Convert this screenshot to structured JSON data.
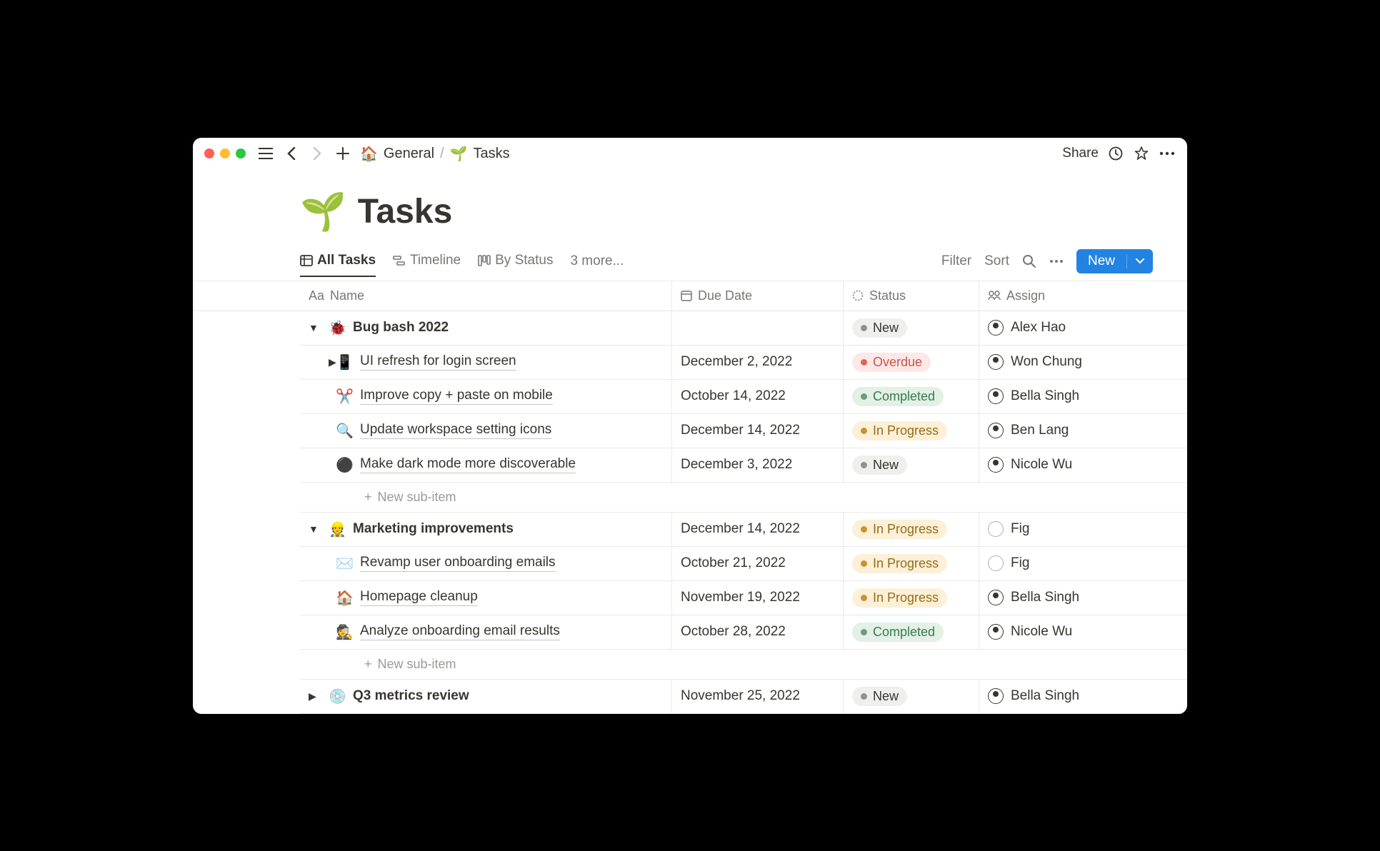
{
  "titlebar": {
    "share": "Share",
    "breadcrumb": {
      "parent_icon": "🏠",
      "parent": "General",
      "current_icon": "🌱",
      "current": "Tasks"
    }
  },
  "page": {
    "emoji": "🌱",
    "title": "Tasks"
  },
  "views": {
    "tabs": [
      {
        "icon": "table",
        "label": "All Tasks",
        "active": true
      },
      {
        "icon": "timeline",
        "label": "Timeline",
        "active": false
      },
      {
        "icon": "board",
        "label": "By Status",
        "active": false
      }
    ],
    "more": "3 more...",
    "actions": {
      "filter": "Filter",
      "sort": "Sort",
      "new": "New"
    }
  },
  "columns": {
    "name": "Name",
    "due": "Due Date",
    "status": "Status",
    "assign": "Assign"
  },
  "newSubItem": "New sub-item",
  "rows": [
    {
      "type": "group",
      "expanded": true,
      "emoji": "🐞",
      "title": "Bug bash 2022",
      "due": "",
      "status": "New",
      "assignee": "Alex Hao"
    },
    {
      "type": "child",
      "toggle": true,
      "emoji": "📱",
      "title": "UI refresh for login screen",
      "due": "December 2, 2022",
      "status": "Overdue",
      "assignee": "Won Chung"
    },
    {
      "type": "child",
      "emoji": "✂️",
      "title": "Improve copy + paste on mobile",
      "due": "October 14, 2022",
      "status": "Completed",
      "assignee": "Bella Singh"
    },
    {
      "type": "child",
      "emoji": "🔍",
      "title": "Update workspace setting icons",
      "due": "December 14, 2022",
      "status": "In Progress",
      "assignee": "Ben Lang"
    },
    {
      "type": "child",
      "emoji": "⚫",
      "title": "Make dark mode more discoverable",
      "due": "December 3, 2022",
      "status": "New",
      "assignee": "Nicole Wu"
    },
    {
      "type": "subnew"
    },
    {
      "type": "group",
      "expanded": true,
      "emoji": "👷",
      "title": "Marketing improvements",
      "due": "December 14, 2022",
      "status": "In Progress",
      "assignee": "Fig",
      "avatar": "cat"
    },
    {
      "type": "child",
      "emoji": "✉️",
      "title": "Revamp user onboarding emails",
      "due": "October 21, 2022",
      "status": "In Progress",
      "assignee": "Fig",
      "avatar": "cat"
    },
    {
      "type": "child",
      "emoji": "🏠",
      "title": "Homepage cleanup",
      "due": "November 19, 2022",
      "status": "In Progress",
      "assignee": "Bella Singh"
    },
    {
      "type": "child",
      "emoji": "🕵️",
      "title": "Analyze onboarding email results",
      "due": "October 28, 2022",
      "status": "Completed",
      "assignee": "Nicole Wu"
    },
    {
      "type": "subnew"
    },
    {
      "type": "group",
      "expanded": false,
      "emoji": "💿",
      "title": "Q3 metrics review",
      "due": "November 25, 2022",
      "status": "New",
      "assignee": "Bella Singh"
    }
  ],
  "statusStyles": {
    "New": "new",
    "Overdue": "overdue",
    "Completed": "completed",
    "In Progress": "inprogress"
  }
}
